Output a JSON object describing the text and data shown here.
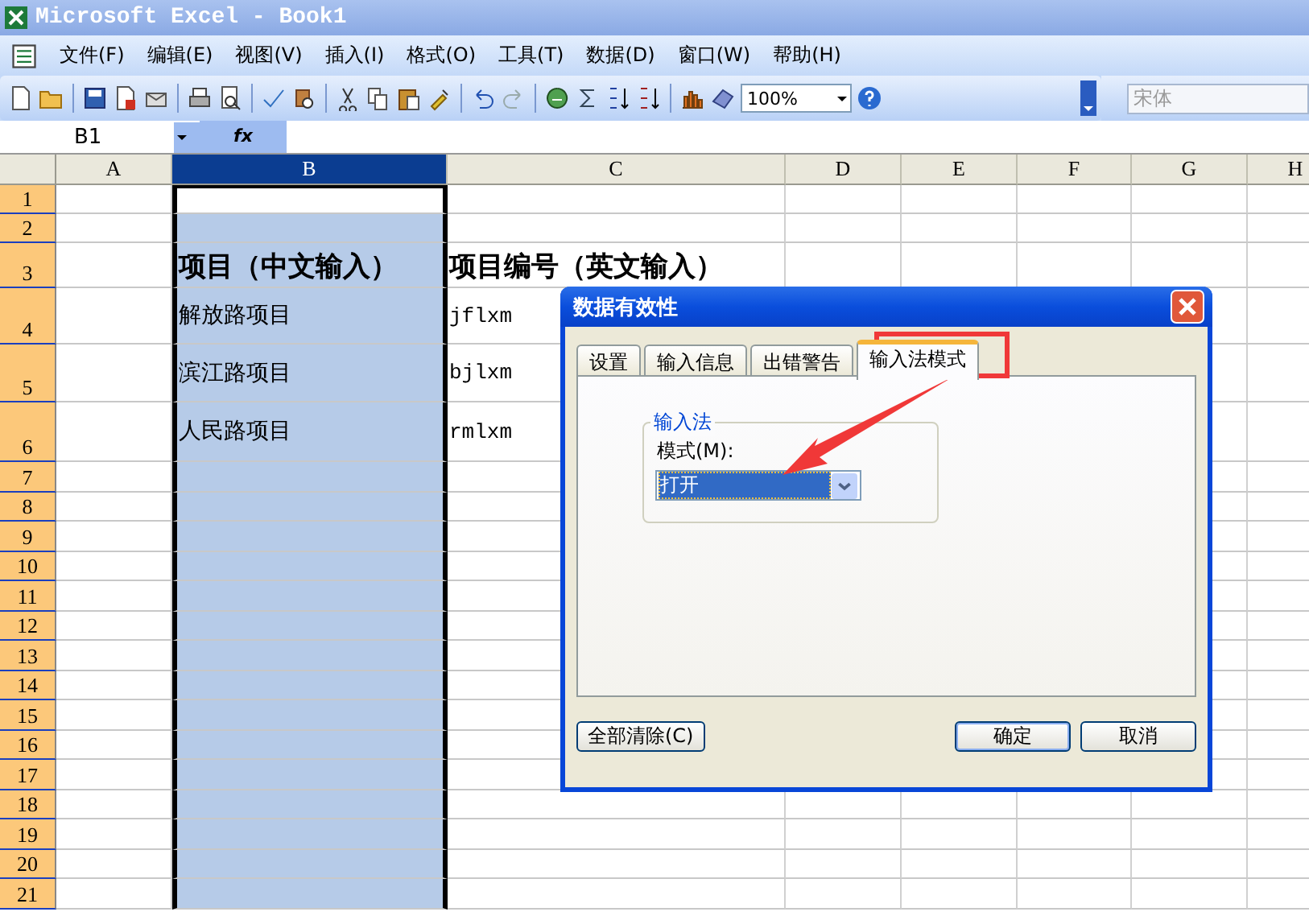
{
  "window": {
    "title": "Microsoft Excel - Book1"
  },
  "menu": [
    "文件(F)",
    "编辑(E)",
    "视图(V)",
    "插入(I)",
    "格式(O)",
    "工具(T)",
    "数据(D)",
    "窗口(W)",
    "帮助(H)"
  ],
  "toolbar": {
    "zoom": "100%",
    "font": "宋体"
  },
  "formula_bar": {
    "name_box": "B1",
    "fx": "fx"
  },
  "columns": [
    {
      "label": "A",
      "selected": false
    },
    {
      "label": "B",
      "selected": true
    },
    {
      "label": "C",
      "selected": false
    },
    {
      "label": "D",
      "selected": false
    },
    {
      "label": "E",
      "selected": false
    },
    {
      "label": "F",
      "selected": false
    },
    {
      "label": "G",
      "selected": false
    },
    {
      "label": "H",
      "selected": false
    }
  ],
  "rows": [
    {
      "number": "1",
      "kind": "plain"
    },
    {
      "number": "2",
      "kind": "plain"
    },
    {
      "number": "3",
      "kind": "heading",
      "b": "项目（中文输入）",
      "c": "项目编号（英文输入）"
    },
    {
      "number": "4",
      "kind": "plain",
      "b": "解放路项目",
      "c": "jflxm"
    },
    {
      "number": "5",
      "kind": "plain",
      "b": "滨江路项目",
      "c": "bjlxm"
    },
    {
      "number": "6",
      "kind": "plain",
      "b": "人民路项目",
      "c": "rmlxm"
    },
    {
      "number": "7",
      "kind": "plain"
    },
    {
      "number": "8",
      "kind": "plain"
    },
    {
      "number": "9",
      "kind": "plain"
    },
    {
      "number": "10",
      "kind": "plain"
    },
    {
      "number": "11",
      "kind": "plain"
    },
    {
      "number": "12",
      "kind": "plain"
    },
    {
      "number": "13",
      "kind": "plain"
    },
    {
      "number": "14",
      "kind": "plain"
    },
    {
      "number": "15",
      "kind": "plain"
    },
    {
      "number": "16",
      "kind": "plain"
    },
    {
      "number": "17",
      "kind": "plain"
    },
    {
      "number": "18",
      "kind": "plain"
    },
    {
      "number": "19",
      "kind": "plain"
    },
    {
      "number": "20",
      "kind": "plain"
    },
    {
      "number": "21",
      "kind": "plain"
    }
  ],
  "dialog": {
    "title": "数据有效性",
    "tabs": [
      {
        "label": "设置",
        "selected": false
      },
      {
        "label": "输入信息",
        "selected": false
      },
      {
        "label": "出错警告",
        "selected": false
      },
      {
        "label": "输入法模式",
        "selected": true
      }
    ],
    "group": "输入法",
    "mode_label": "模式(M):",
    "mode_value": "打开",
    "buttons": [
      {
        "label": "全部清除(C)",
        "kind": "left"
      },
      {
        "label": "确定",
        "kind": "default"
      },
      {
        "label": "取消",
        "kind": "normal"
      }
    ]
  }
}
